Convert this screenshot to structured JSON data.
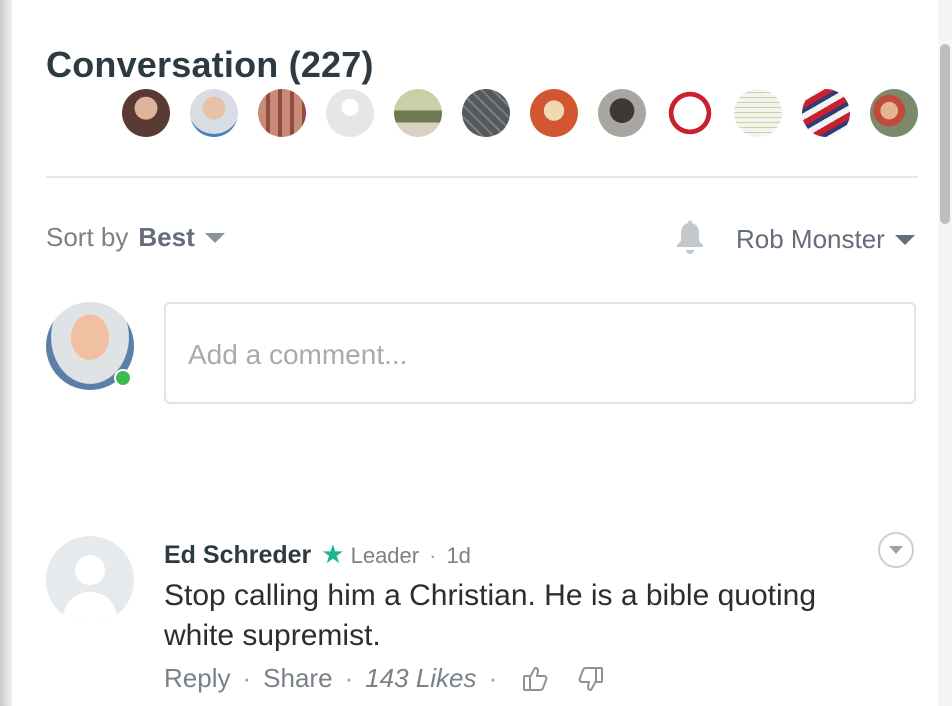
{
  "header": {
    "title": "Conversation (227)"
  },
  "participants": [
    {
      "icon": "participant-avatar-1",
      "color": "#8a5a4a"
    },
    {
      "icon": "participant-avatar-2",
      "color": "#c6cdd4"
    },
    {
      "icon": "participant-avatar-3",
      "color": "#b5766b"
    },
    {
      "icon": "participant-avatar-4",
      "color": "#e4e6e8"
    },
    {
      "icon": "participant-avatar-5",
      "color": "#9aa58a"
    },
    {
      "icon": "participant-avatar-6",
      "color": "#5a5d60"
    },
    {
      "icon": "participant-avatar-7",
      "color": "#d2562f"
    },
    {
      "icon": "participant-avatar-8",
      "color": "#6d6a66"
    },
    {
      "icon": "participant-avatar-9",
      "color": "#c8202e"
    },
    {
      "icon": "participant-avatar-10",
      "color": "#f1f2ee"
    },
    {
      "icon": "participant-avatar-11",
      "color": "#3b4b7a"
    },
    {
      "icon": "participant-avatar-12",
      "color": "#9b6b55"
    }
  ],
  "sort": {
    "label": "Sort by",
    "value": "Best"
  },
  "user": {
    "name": "Rob Monster"
  },
  "composer": {
    "placeholder": "Add a comment..."
  },
  "comment": {
    "author": "Ed Schreder",
    "badge": "Leader",
    "time": "1d",
    "text": "Stop calling him a Christian. He is a bible quoting white supremist.",
    "reply": "Reply",
    "share": "Share",
    "likes": "143 Likes"
  },
  "colors": {
    "accent_green": "#1fb58c",
    "online": "#3fb950"
  }
}
